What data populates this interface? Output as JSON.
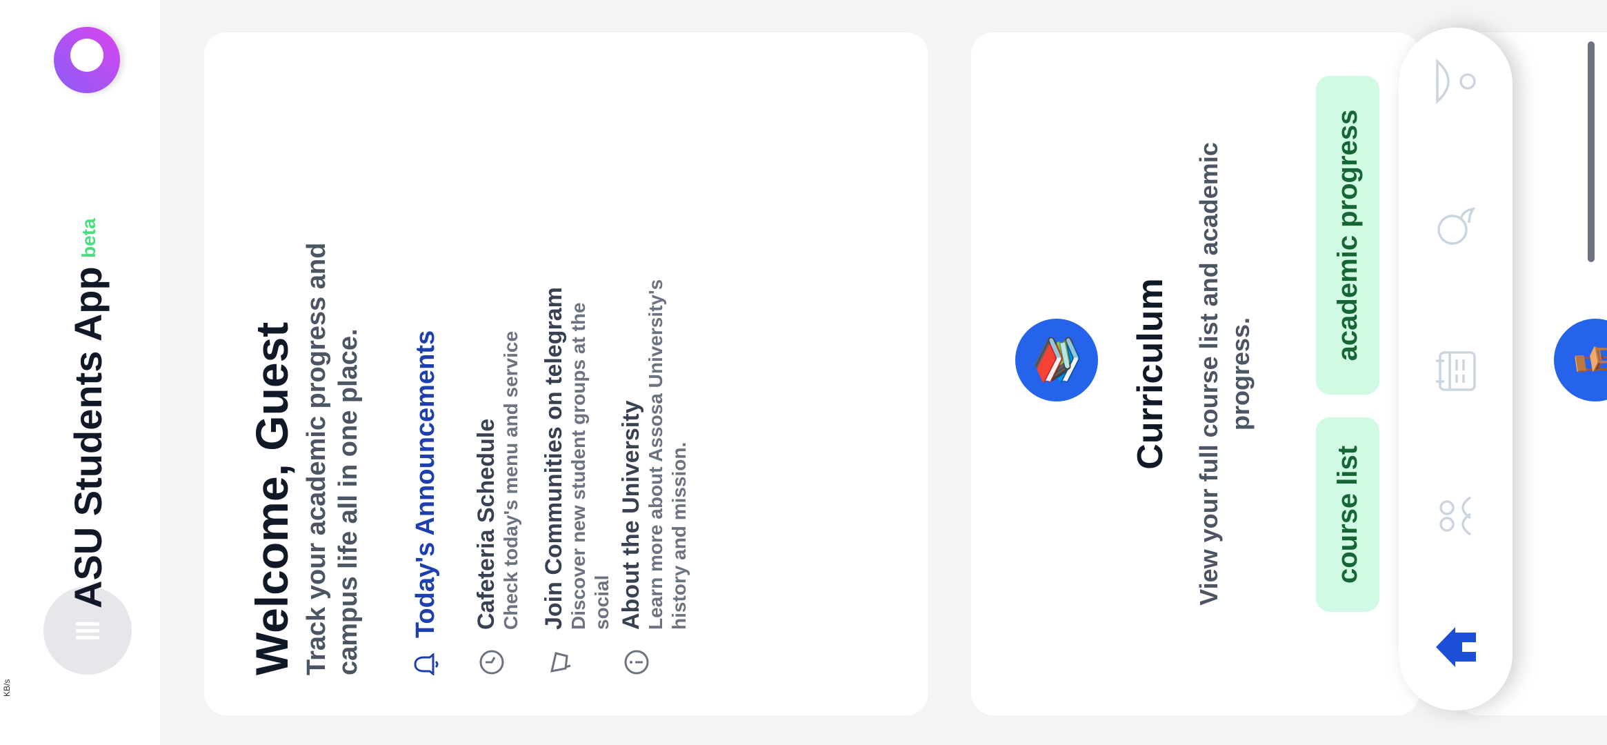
{
  "status_bar": {
    "speed": "KB/s"
  },
  "app": {
    "title": "ASU Students App",
    "badge": "beta"
  },
  "welcome": {
    "title": "Welcome, Guest",
    "subtitle": "Track your academic progress and campus life all in one place.",
    "announcements_title": "Today's Announcements",
    "items": [
      {
        "title": "Cafeteria Schedule",
        "desc": "Check today's menu and service",
        "icon": "clock-icon"
      },
      {
        "title": "Join Communities on telegram",
        "desc": "Discover new student groups at the social",
        "icon": "megaphone-icon"
      },
      {
        "title": "About the University",
        "desc": "Learn more about Assosa University's history and mission.",
        "icon": "info-icon"
      }
    ]
  },
  "curriculum": {
    "title": "Curriculum",
    "desc": "View your full course list and academic progress.",
    "buttons": [
      "course list",
      "academic progress"
    ]
  },
  "nav": {
    "items": [
      "home-icon",
      "groups-icon",
      "calendar-icon",
      "chat-icon",
      "profile-icon"
    ],
    "active_color": "#1d4ed8",
    "inactive_color": "#cbd5e1"
  }
}
